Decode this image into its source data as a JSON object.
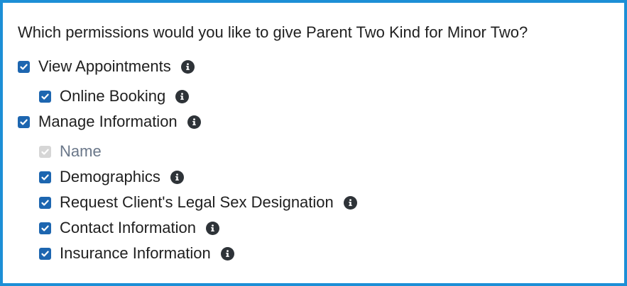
{
  "question": "Which permissions would you like to give Parent Two Kind for Minor Two?",
  "permissions": [
    {
      "label": "View Appointments",
      "checked": true,
      "disabled": false,
      "info": true
    },
    {
      "label": "Online Booking",
      "checked": true,
      "disabled": false,
      "info": true
    },
    {
      "label": "Manage Information",
      "checked": true,
      "disabled": false,
      "info": true
    },
    {
      "label": "Name",
      "checked": true,
      "disabled": true,
      "info": false
    },
    {
      "label": "Demographics",
      "checked": true,
      "disabled": false,
      "info": true
    },
    {
      "label": "Request Client's Legal Sex Designation",
      "checked": true,
      "disabled": false,
      "info": true
    },
    {
      "label": "Contact Information",
      "checked": true,
      "disabled": false,
      "info": true
    },
    {
      "label": "Insurance Information",
      "checked": true,
      "disabled": false,
      "info": true
    }
  ],
  "colors": {
    "border": "#1c8fd6",
    "checkbox": "#1d66b0",
    "checkbox_disabled": "#d6d6d6",
    "info_icon": "#2e3338",
    "muted_text": "#6a7789"
  }
}
